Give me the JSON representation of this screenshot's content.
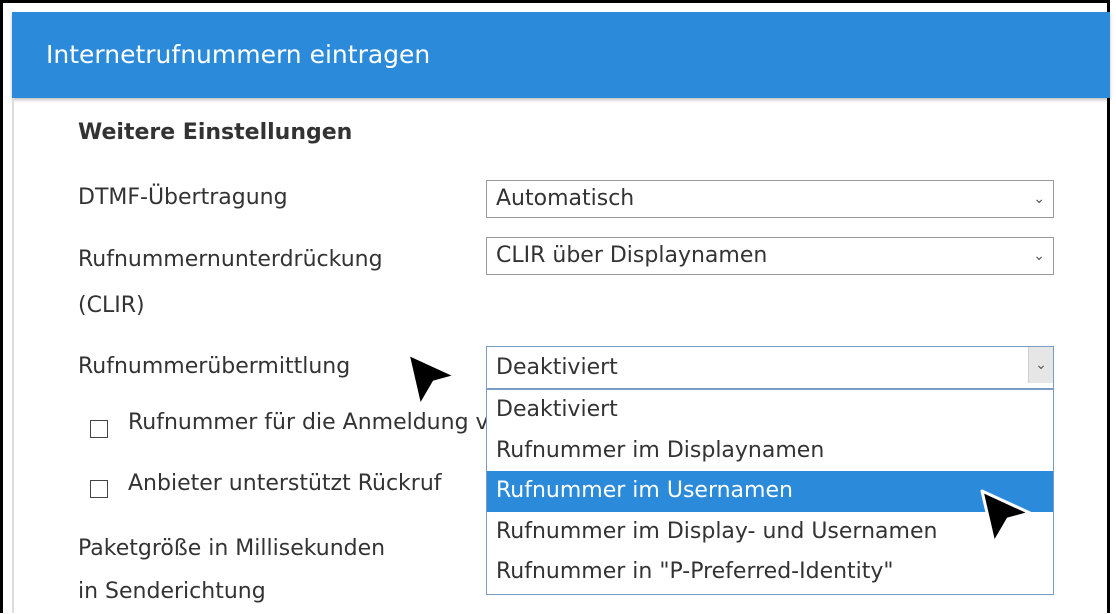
{
  "dialog": {
    "title": "Internetrufnummern eintragen"
  },
  "section": {
    "title": "Weitere Einstellungen"
  },
  "fields": {
    "dtmf": {
      "label": "DTMF-Übertragung",
      "value": "Automatisch"
    },
    "clir": {
      "label_line1": "Rufnummernunterdrückung",
      "label_line2": "(CLIR)",
      "value": "CLIR über Displaynamen"
    },
    "transfer": {
      "label": "Rufnummerübermittlung",
      "value": "Deaktiviert",
      "options": [
        "Deaktiviert",
        "Rufnummer im Displaynamen",
        "Rufnummer im Usernamen",
        "Rufnummer im Display- und Usernamen",
        "Rufnummer in \"P-Preferred-Identity\""
      ],
      "highlighted_option": "Rufnummer im Usernamen"
    },
    "checkbox_login": {
      "label": "Rufnummer für die Anmeldung verwenden",
      "checked": false
    },
    "checkbox_callback": {
      "label": "Anbieter unterstützt Rückruf",
      "checked": false
    },
    "packet_size": {
      "label_line1": "Paketgröße in Millisekunden",
      "label_line2": "in Senderichtung"
    }
  },
  "colors": {
    "header": "#2b8ad9",
    "highlight": "#2b8ad9"
  },
  "icons": {
    "select_chevron": "chevron-down-icon",
    "cursor": "mouse-pointer-icon"
  }
}
